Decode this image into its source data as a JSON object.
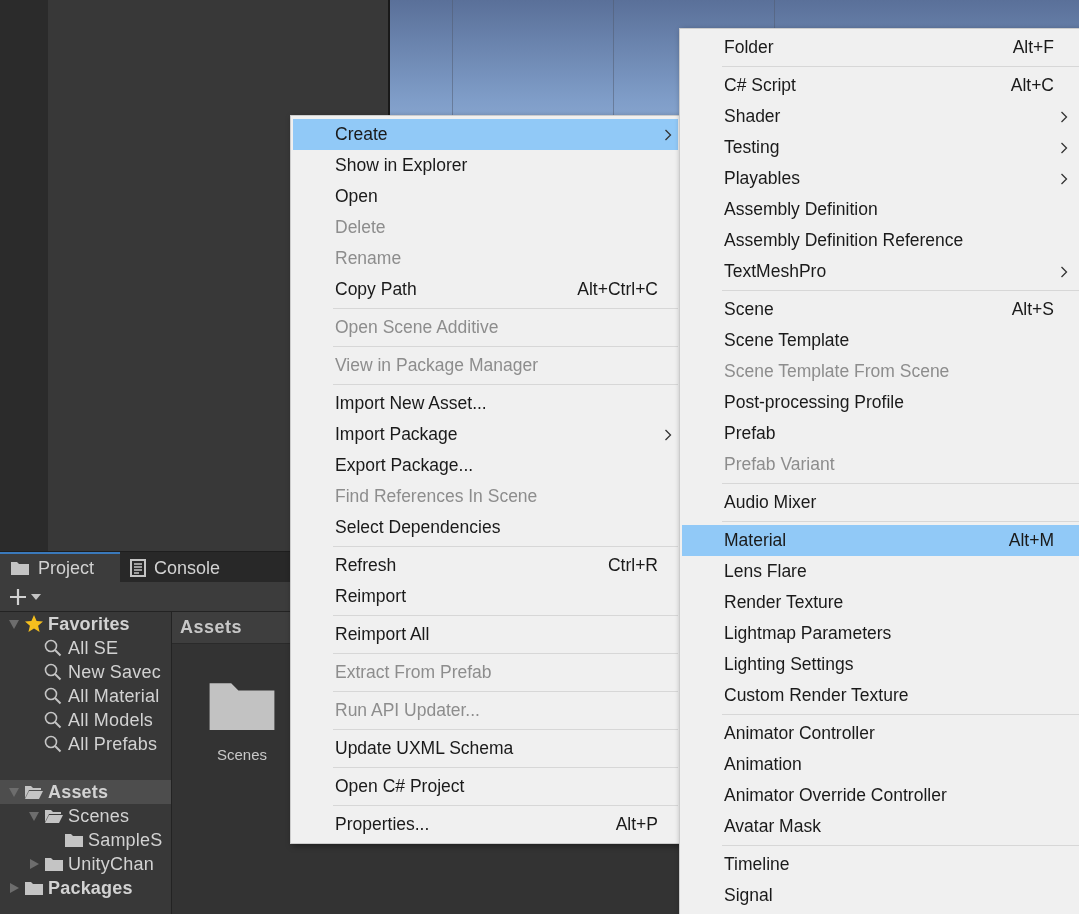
{
  "project_panel": {
    "tabs": [
      {
        "label": "Project",
        "kind": "project",
        "selected": true
      },
      {
        "label": "Console",
        "kind": "console",
        "selected": false
      }
    ],
    "tree_sections": [
      [
        {
          "label": "Favorites",
          "kind": "favorites",
          "expanded": true,
          "selected": false,
          "children": [
            {
              "label": "All SE",
              "kind": "search",
              "selected": false
            },
            {
              "label": "New Savec",
              "kind": "search",
              "selected": false
            },
            {
              "label": "All Material",
              "kind": "search",
              "selected": false
            },
            {
              "label": "All Models",
              "kind": "search",
              "selected": false
            },
            {
              "label": "All Prefabs",
              "kind": "search",
              "selected": false
            }
          ]
        }
      ],
      [
        {
          "label": "Assets",
          "kind": "folder",
          "expanded": true,
          "selected": true,
          "children": [
            {
              "label": "Scenes",
              "kind": "folder",
              "expanded": true,
              "selected": false,
              "children": [
                {
                  "label": "SampleS",
                  "kind": "folder",
                  "selected": false
                }
              ]
            },
            {
              "label": "UnityChan",
              "kind": "folder",
              "expanded": false,
              "selected": false
            }
          ]
        },
        {
          "label": "Packages",
          "kind": "folder",
          "expanded": false,
          "selected": false
        }
      ]
    ],
    "breadcrumb": "Assets",
    "grid_items": [
      {
        "label": "Scenes"
      }
    ]
  },
  "context_menu": {
    "groups": [
      [
        {
          "label": "Create",
          "selected": true,
          "disabled": false,
          "submenu": true
        },
        {
          "label": "Show in Explorer",
          "selected": false,
          "disabled": false
        },
        {
          "label": "Open",
          "selected": false,
          "disabled": false
        },
        {
          "label": "Delete",
          "selected": false,
          "disabled": true
        },
        {
          "label": "Rename",
          "selected": false,
          "disabled": true
        },
        {
          "label": "Copy Path",
          "shortcut": "Alt+Ctrl+C",
          "selected": false,
          "disabled": false
        }
      ],
      [
        {
          "label": "Open Scene Additive",
          "selected": false,
          "disabled": true
        }
      ],
      [
        {
          "label": "View in Package Manager",
          "selected": false,
          "disabled": true
        }
      ],
      [
        {
          "label": "Import New Asset...",
          "selected": false,
          "disabled": false
        },
        {
          "label": "Import Package",
          "selected": false,
          "disabled": false,
          "submenu": true
        },
        {
          "label": "Export Package...",
          "selected": false,
          "disabled": false
        },
        {
          "label": "Find References In Scene",
          "selected": false,
          "disabled": true
        },
        {
          "label": "Select Dependencies",
          "selected": false,
          "disabled": false
        }
      ],
      [
        {
          "label": "Refresh",
          "shortcut": "Ctrl+R",
          "selected": false,
          "disabled": false
        },
        {
          "label": "Reimport",
          "selected": false,
          "disabled": false
        }
      ],
      [
        {
          "label": "Reimport All",
          "selected": false,
          "disabled": false
        }
      ],
      [
        {
          "label": "Extract From Prefab",
          "selected": false,
          "disabled": true
        }
      ],
      [
        {
          "label": "Run API Updater...",
          "selected": false,
          "disabled": true
        }
      ],
      [
        {
          "label": "Update UXML Schema",
          "selected": false,
          "disabled": false
        }
      ],
      [
        {
          "label": "Open C# Project",
          "selected": false,
          "disabled": false
        }
      ],
      [
        {
          "label": "Properties...",
          "shortcut": "Alt+P",
          "selected": false,
          "disabled": false
        }
      ]
    ]
  },
  "create_submenu": {
    "groups": [
      [
        {
          "label": "Folder",
          "shortcut": "Alt+F",
          "selected": false,
          "disabled": false
        }
      ],
      [
        {
          "label": "C# Script",
          "shortcut": "Alt+C",
          "selected": false,
          "disabled": false
        },
        {
          "label": "Shader",
          "selected": false,
          "disabled": false,
          "submenu": true
        },
        {
          "label": "Testing",
          "selected": false,
          "disabled": false,
          "submenu": true
        },
        {
          "label": "Playables",
          "selected": false,
          "disabled": false,
          "submenu": true
        },
        {
          "label": "Assembly Definition",
          "selected": false,
          "disabled": false
        },
        {
          "label": "Assembly Definition Reference",
          "selected": false,
          "disabled": false
        },
        {
          "label": "TextMeshPro",
          "selected": false,
          "disabled": false,
          "submenu": true
        }
      ],
      [
        {
          "label": "Scene",
          "shortcut": "Alt+S",
          "selected": false,
          "disabled": false
        },
        {
          "label": "Scene Template",
          "selected": false,
          "disabled": false
        },
        {
          "label": "Scene Template From Scene",
          "selected": false,
          "disabled": true
        },
        {
          "label": "Post-processing Profile",
          "selected": false,
          "disabled": false
        },
        {
          "label": "Prefab",
          "selected": false,
          "disabled": false
        },
        {
          "label": "Prefab Variant",
          "selected": false,
          "disabled": true
        }
      ],
      [
        {
          "label": "Audio Mixer",
          "selected": false,
          "disabled": false
        }
      ],
      [
        {
          "label": "Material",
          "shortcut": "Alt+M",
          "selected": true,
          "disabled": false
        },
        {
          "label": "Lens Flare",
          "selected": false,
          "disabled": false
        },
        {
          "label": "Render Texture",
          "selected": false,
          "disabled": false
        },
        {
          "label": "Lightmap Parameters",
          "selected": false,
          "disabled": false
        },
        {
          "label": "Lighting Settings",
          "selected": false,
          "disabled": false
        },
        {
          "label": "Custom Render Texture",
          "selected": false,
          "disabled": false
        }
      ],
      [
        {
          "label": "Animator Controller",
          "selected": false,
          "disabled": false
        },
        {
          "label": "Animation",
          "selected": false,
          "disabled": false
        },
        {
          "label": "Animator Override Controller",
          "selected": false,
          "disabled": false
        },
        {
          "label": "Avatar Mask",
          "selected": false,
          "disabled": false
        }
      ],
      [
        {
          "label": "Timeline",
          "selected": false,
          "disabled": false
        },
        {
          "label": "Signal",
          "selected": false,
          "disabled": false
        }
      ]
    ]
  }
}
